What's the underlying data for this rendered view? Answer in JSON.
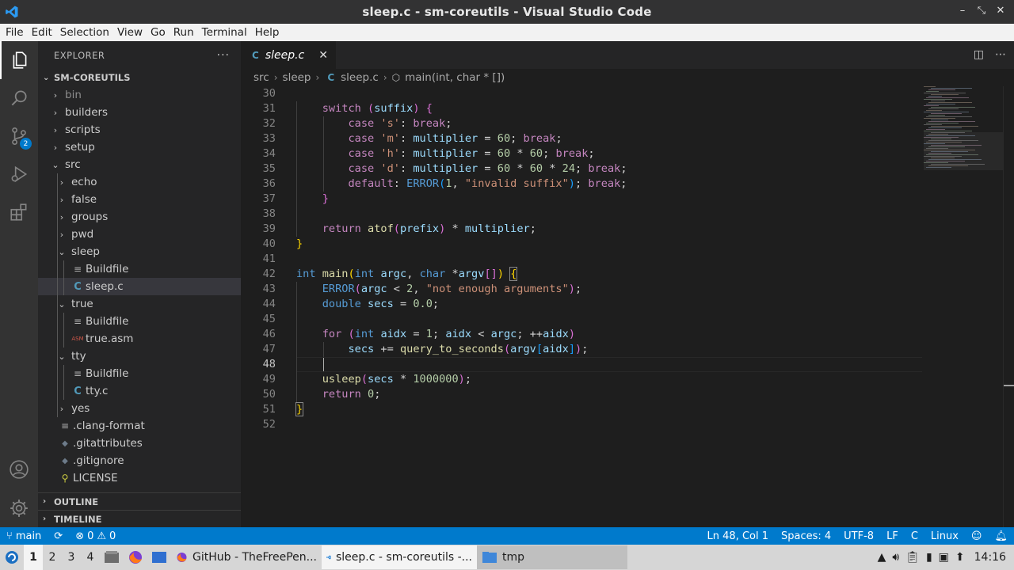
{
  "window": {
    "title": "sleep.c - sm-coreutils - Visual Studio Code",
    "buttons": [
      "–",
      "⤡",
      "✕"
    ]
  },
  "menu": [
    "File",
    "Edit",
    "Selection",
    "View",
    "Go",
    "Run",
    "Terminal",
    "Help"
  ],
  "activity": {
    "scm_badge": "2"
  },
  "sidebar": {
    "header": "EXPLORER",
    "more": "···",
    "root": "SM-COREUTILS",
    "items": [
      {
        "label": "bin",
        "type": "folder",
        "open": false,
        "depth": 1,
        "dim": true
      },
      {
        "label": "builders",
        "type": "folder",
        "open": false,
        "depth": 1
      },
      {
        "label": "scripts",
        "type": "folder",
        "open": false,
        "depth": 1
      },
      {
        "label": "setup",
        "type": "folder",
        "open": false,
        "depth": 1
      },
      {
        "label": "src",
        "type": "folder",
        "open": true,
        "depth": 1
      },
      {
        "label": "echo",
        "type": "folder",
        "open": false,
        "depth": 2
      },
      {
        "label": "false",
        "type": "folder",
        "open": false,
        "depth": 2
      },
      {
        "label": "groups",
        "type": "folder",
        "open": false,
        "depth": 2
      },
      {
        "label": "pwd",
        "type": "folder",
        "open": false,
        "depth": 2
      },
      {
        "label": "sleep",
        "type": "folder",
        "open": true,
        "depth": 2
      },
      {
        "label": "Buildfile",
        "type": "lines",
        "depth": 3
      },
      {
        "label": "sleep.c",
        "type": "c",
        "depth": 3,
        "selected": true
      },
      {
        "label": "true",
        "type": "folder",
        "open": true,
        "depth": 2
      },
      {
        "label": "Buildfile",
        "type": "lines",
        "depth": 3
      },
      {
        "label": "true.asm",
        "type": "asm",
        "depth": 3
      },
      {
        "label": "tty",
        "type": "folder",
        "open": true,
        "depth": 2
      },
      {
        "label": "Buildfile",
        "type": "lines",
        "depth": 3
      },
      {
        "label": "tty.c",
        "type": "c",
        "depth": 3
      },
      {
        "label": "yes",
        "type": "folder",
        "open": false,
        "depth": 2
      },
      {
        "label": ".clang-format",
        "type": "lines",
        "depth": 1
      },
      {
        "label": ".gitattributes",
        "type": "diamond",
        "depth": 1
      },
      {
        "label": ".gitignore",
        "type": "diamond",
        "depth": 1
      },
      {
        "label": "LICENSE",
        "type": "license",
        "depth": 1
      }
    ],
    "outline": "OUTLINE",
    "timeline": "TIMELINE"
  },
  "editor": {
    "tab": {
      "label": "sleep.c",
      "close": "✕"
    },
    "breadcrumb": {
      "src": "src",
      "sleep": "sleep",
      "file": "sleep.c",
      "symbol": "main(int, char * [])"
    },
    "current_line": 48
  },
  "code_lines": [
    {
      "n": "30",
      "html": ""
    },
    {
      "n": "31",
      "html": "    <span class=\"kw\">switch</span> <span class=\"br2\">(</span><span class=\"va\">suffix</span><span class=\"br2\">)</span> <span class=\"br2\">{</span>"
    },
    {
      "n": "32",
      "html": "        <span class=\"kw\">case</span> <span class=\"st\">'s'</span>: <span class=\"kw\">break</span>;"
    },
    {
      "n": "33",
      "html": "        <span class=\"kw\">case</span> <span class=\"st\">'m'</span>: <span class=\"va\">multiplier</span> = <span class=\"nu\">60</span>; <span class=\"kw\">break</span>;"
    },
    {
      "n": "34",
      "html": "        <span class=\"kw\">case</span> <span class=\"st\">'h'</span>: <span class=\"va\">multiplier</span> = <span class=\"nu\">60</span> * <span class=\"nu\">60</span>; <span class=\"kw\">break</span>;"
    },
    {
      "n": "35",
      "html": "        <span class=\"kw\">case</span> <span class=\"st\">'d'</span>: <span class=\"va\">multiplier</span> = <span class=\"nu\">60</span> * <span class=\"nu\">60</span> * <span class=\"nu\">24</span>; <span class=\"kw\">break</span>;"
    },
    {
      "n": "36",
      "html": "        <span class=\"kw\">default</span>: <span class=\"ty\">ERROR</span><span class=\"br3\">(</span><span class=\"nu\">1</span>, <span class=\"st\">\"invalid suffix\"</span><span class=\"br3\">)</span>; <span class=\"kw\">break</span>;"
    },
    {
      "n": "37",
      "html": "    <span class=\"br2\">}</span>"
    },
    {
      "n": "38",
      "html": ""
    },
    {
      "n": "39",
      "html": "    <span class=\"kw\">return</span> <span class=\"fn\">atof</span><span class=\"br2\">(</span><span class=\"va\">prefix</span><span class=\"br2\">)</span> * <span class=\"va\">multiplier</span>;"
    },
    {
      "n": "40",
      "html": "<span class=\"br1\">}</span>"
    },
    {
      "n": "41",
      "html": ""
    },
    {
      "n": "42",
      "html": "<span class=\"ty\">int</span> <span class=\"fn\">main</span><span class=\"br1\">(</span><span class=\"ty\">int</span> <span class=\"va\">argc</span>, <span class=\"ty\">char</span> *<span class=\"va\">argv</span><span class=\"br2\">[]</span><span class=\"br1\">)</span> <span class=\"brm\">{</span>"
    },
    {
      "n": "43",
      "html": "    <span class=\"ty\">ERROR</span><span class=\"br2\">(</span><span class=\"va\">argc</span> &lt; <span class=\"nu\">2</span>, <span class=\"st\">\"not enough arguments\"</span><span class=\"br2\">)</span>;"
    },
    {
      "n": "44",
      "html": "    <span class=\"ty\">double</span> <span class=\"va\">secs</span> = <span class=\"nu\">0.0</span>;"
    },
    {
      "n": "45",
      "html": ""
    },
    {
      "n": "46",
      "html": "    <span class=\"kw\">for</span> <span class=\"br2\">(</span><span class=\"ty\">int</span> <span class=\"va\">aidx</span> = <span class=\"nu\">1</span>; <span class=\"va\">aidx</span> &lt; <span class=\"va\">argc</span>; ++<span class=\"va\">aidx</span><span class=\"br2\">)</span>"
    },
    {
      "n": "47",
      "html": "        <span class=\"va\">secs</span> += <span class=\"fn\">query_to_seconds</span><span class=\"br2\">(</span><span class=\"va\">argv</span><span class=\"br3\">[</span><span class=\"va\">aidx</span><span class=\"br3\">]</span><span class=\"br2\">)</span>;"
    },
    {
      "n": "48",
      "html": ""
    },
    {
      "n": "49",
      "html": "    <span class=\"fn\">usleep</span><span class=\"br2\">(</span><span class=\"va\">secs</span> * <span class=\"nu\">1000000</span><span class=\"br2\">)</span>;"
    },
    {
      "n": "50",
      "html": "    <span class=\"kw\">return</span> <span class=\"nu\">0</span>;"
    },
    {
      "n": "51",
      "html": "<span class=\"brm\">}</span>"
    },
    {
      "n": "52",
      "html": ""
    }
  ],
  "statusbar": {
    "branch": "main",
    "errors": "0",
    "warnings": "0",
    "position": "Ln 48, Col 1",
    "spaces": "Spaces: 4",
    "encoding": "UTF-8",
    "eol": "LF",
    "language": "C",
    "platform": "Linux"
  },
  "taskbar": {
    "workspaces": [
      "1",
      "2",
      "3",
      "4"
    ],
    "tasks": [
      {
        "label": "GitHub - TheFreePen...",
        "kind": "firefox"
      },
      {
        "label": "sleep.c - sm-coreutils -...",
        "kind": "vscode",
        "active": true
      },
      {
        "label": "tmp",
        "kind": "folder"
      }
    ],
    "clock": "14:16"
  },
  "colors": {
    "accent": "#007acc",
    "titlebar": "#323233",
    "editor_bg": "#1e1e1e",
    "sidebar_bg": "#252526"
  }
}
